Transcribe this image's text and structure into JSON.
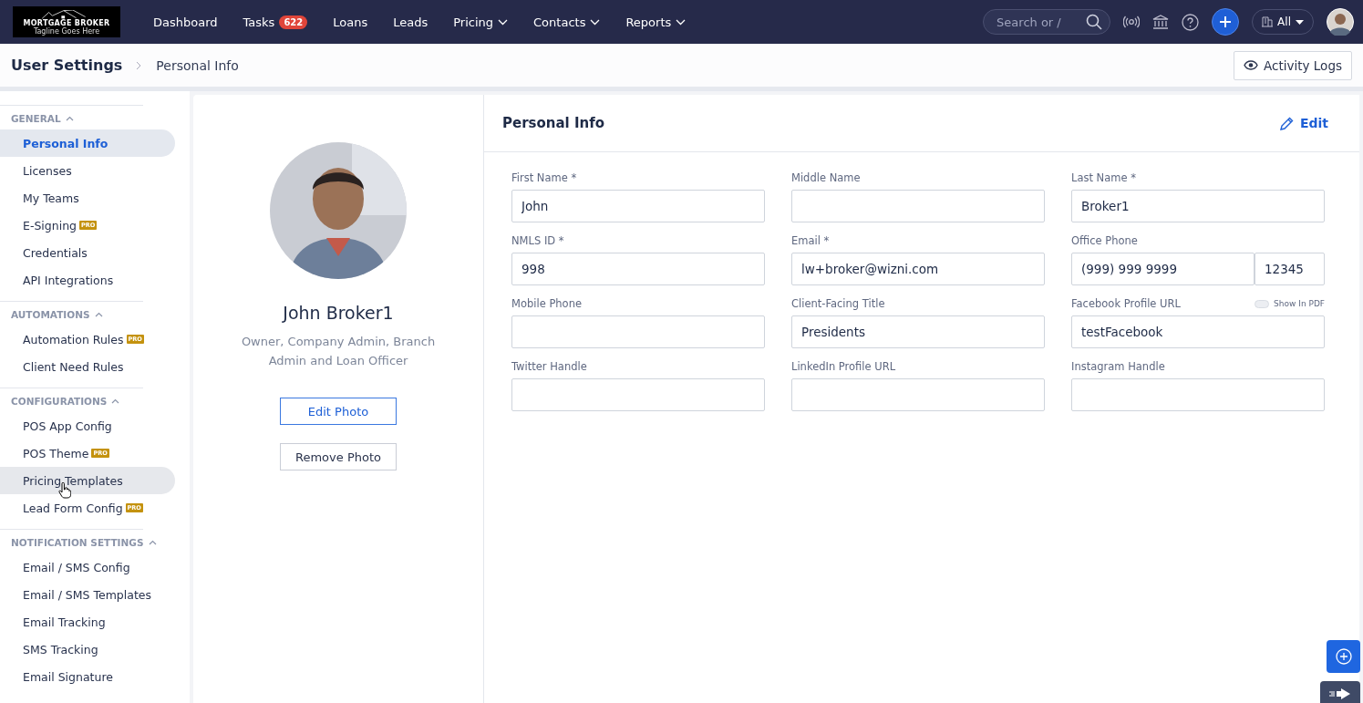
{
  "logo": {
    "title": "MORTGAGE BROKER",
    "tagline": "Tagline Goes Here"
  },
  "nav": [
    {
      "label": "Dashboard",
      "dropdown": false
    },
    {
      "label": "Tasks",
      "badge": "622",
      "dropdown": false
    },
    {
      "label": "Loans",
      "dropdown": false
    },
    {
      "label": "Leads",
      "dropdown": false
    },
    {
      "label": "Pricing",
      "dropdown": true
    },
    {
      "label": "Contacts",
      "dropdown": true
    },
    {
      "label": "Reports",
      "dropdown": true
    }
  ],
  "search": {
    "placeholder": "Search or /"
  },
  "scope": {
    "value": "All"
  },
  "breadcrumb": [
    "User Settings",
    "Personal Info"
  ],
  "activity_button": "Activity Logs",
  "sidebar": [
    {
      "title": "GENERAL",
      "expanded": true,
      "items": [
        {
          "label": "Personal Info",
          "selected": true,
          "hovered": false
        },
        {
          "label": "Licenses",
          "selected": false,
          "hovered": false
        },
        {
          "label": "My Teams",
          "selected": false,
          "hovered": false
        },
        {
          "label": "E-Signing",
          "badge": "PRO",
          "selected": false,
          "hovered": false
        },
        {
          "label": "Credentials",
          "selected": false,
          "hovered": false
        },
        {
          "label": "API Integrations",
          "selected": false,
          "hovered": false
        }
      ]
    },
    {
      "title": "AUTOMATIONS",
      "expanded": true,
      "items": [
        {
          "label": "Automation Rules",
          "badge": "PRO",
          "selected": false,
          "hovered": false
        },
        {
          "label": "Client Need Rules",
          "selected": false,
          "hovered": false
        }
      ]
    },
    {
      "title": "CONFIGURATIONS",
      "expanded": true,
      "items": [
        {
          "label": "POS App Config",
          "selected": false,
          "hovered": false
        },
        {
          "label": "POS Theme",
          "badge": "PRO",
          "selected": false,
          "hovered": false
        },
        {
          "label": "Pricing Templates",
          "selected": false,
          "hovered": true
        },
        {
          "label": "Lead Form Config",
          "badge": "PRO",
          "selected": false,
          "hovered": false
        }
      ]
    },
    {
      "title": "NOTIFICATION SETTINGS",
      "expanded": true,
      "items": [
        {
          "label": "Email / SMS Config",
          "selected": false,
          "hovered": false
        },
        {
          "label": "Email / SMS Templates",
          "selected": false,
          "hovered": false
        },
        {
          "label": "Email Tracking",
          "selected": false,
          "hovered": false
        },
        {
          "label": "SMS Tracking",
          "selected": false,
          "hovered": false
        },
        {
          "label": "Email Signature",
          "selected": false,
          "hovered": false
        }
      ]
    }
  ],
  "profile": {
    "name": "John Broker1",
    "roles": "Owner, Company Admin, Branch Admin and Loan Officer",
    "edit_photo": "Edit Photo",
    "remove_photo": "Remove Photo"
  },
  "form": {
    "title": "Personal Info",
    "edit": "Edit",
    "fields": [
      {
        "label": "First Name *",
        "value": "John"
      },
      {
        "label": "Middle Name"
      },
      {
        "label": "Last Name *",
        "value": "Broker1"
      },
      {
        "label": "NMLS ID *",
        "value": "998"
      },
      {
        "label": "Email *",
        "value": "lw+broker@wizni.com"
      },
      {
        "label": "Office Phone",
        "value": "(999) 999 9999",
        "extension": "12345"
      },
      {
        "label": "Mobile Phone"
      },
      {
        "label": "Client-Facing Title",
        "value": "Presidents"
      },
      {
        "label": "Facebook Profile URL",
        "value": "testFacebook",
        "toggle": {
          "label": "Show In PDF",
          "on": false
        }
      },
      {
        "label": "Twitter Handle"
      },
      {
        "label": "LinkedIn Profile URL"
      },
      {
        "label": "Instagram Handle"
      }
    ]
  }
}
